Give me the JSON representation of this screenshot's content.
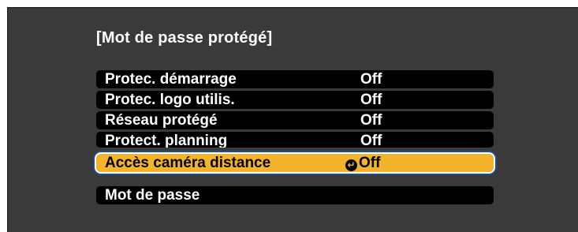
{
  "menu": {
    "title": "[Mot de passe protégé]",
    "items": [
      {
        "label": "Protec. démarrage",
        "value": "Off"
      },
      {
        "label": "Protec. logo utilis.",
        "value": "Off"
      },
      {
        "label": "Réseau protégé",
        "value": "Off"
      },
      {
        "label": "Protect. planning",
        "value": "Off"
      },
      {
        "label": "Accès caméra distance",
        "value": "Off",
        "selected": true
      }
    ],
    "password_label": "Mot de passe"
  },
  "colors": {
    "background": "#3a3a3a",
    "item_background": "#000000",
    "highlight": "#f3b42c",
    "focus_ring": "#1e4f86"
  },
  "icons": {
    "enter": "enter-icon"
  }
}
